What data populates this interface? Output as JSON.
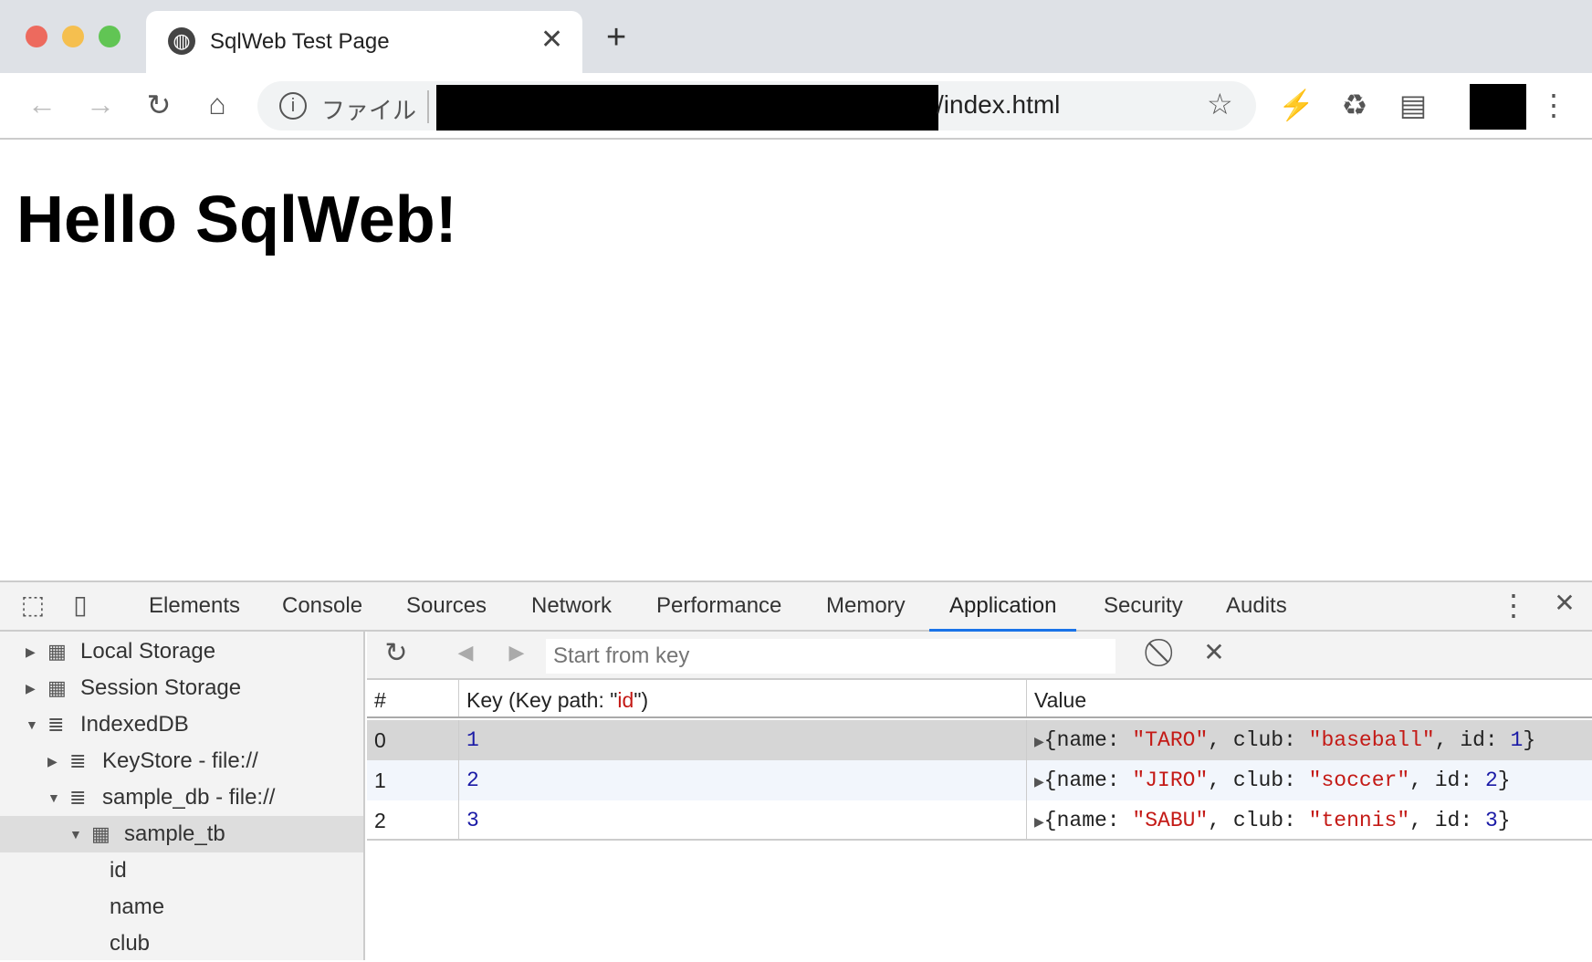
{
  "browser": {
    "tab_title": "SqlWeb Test Page",
    "url_scheme": "ファイル",
    "url_visible": "/index.html"
  },
  "page": {
    "heading": "Hello SqlWeb!"
  },
  "devtools": {
    "tabs": [
      "Elements",
      "Console",
      "Sources",
      "Network",
      "Performance",
      "Memory",
      "Application",
      "Security",
      "Audits"
    ],
    "active_tab": "Application",
    "sidebar": [
      {
        "label": "Local Storage",
        "icon": "grid-icon",
        "expanded": false
      },
      {
        "label": "Session Storage",
        "icon": "grid-icon",
        "expanded": false
      },
      {
        "label": "IndexedDB",
        "icon": "database-icon",
        "expanded": true
      },
      {
        "label": "KeyStore - file://",
        "icon": "database-icon",
        "expanded": false
      },
      {
        "label": "sample_db - file://",
        "icon": "database-icon",
        "expanded": true
      },
      {
        "label": "sample_tb",
        "icon": "grid-icon",
        "expanded": true,
        "selected": true
      },
      {
        "label": "id"
      },
      {
        "label": "name"
      },
      {
        "label": "club"
      }
    ],
    "toolbar": {
      "start_key_placeholder": "Start from key"
    },
    "table": {
      "headers": {
        "index": "#",
        "key_prefix": "Key (Key path: \"",
        "key_path": "id",
        "key_suffix": "\")",
        "value": "Value"
      },
      "rows": [
        {
          "index": "0",
          "key": "1",
          "name": "TARO",
          "club": "baseball",
          "id": "1"
        },
        {
          "index": "1",
          "key": "2",
          "name": "JIRO",
          "club": "soccer",
          "id": "2"
        },
        {
          "index": "2",
          "key": "3",
          "name": "SABU",
          "club": "tennis",
          "id": "3"
        }
      ]
    }
  },
  "colors": {
    "accent": "#1a73e8",
    "string": "#c41a16",
    "number": "#1a1aa6"
  }
}
